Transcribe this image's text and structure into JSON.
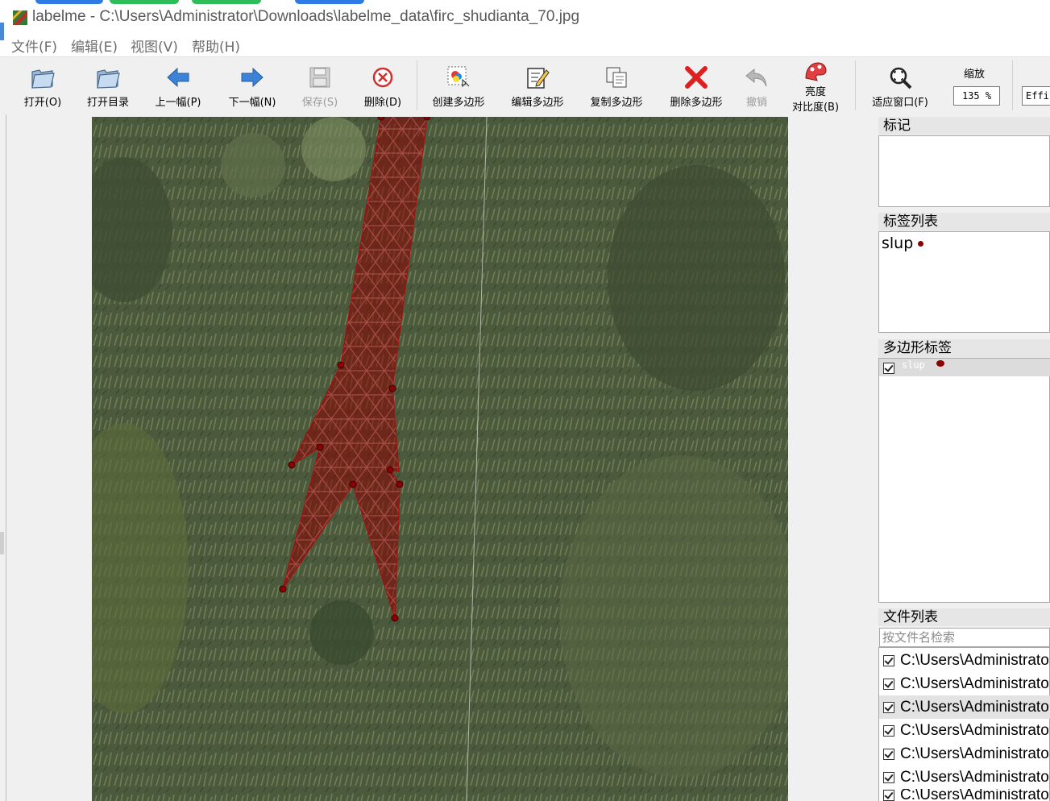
{
  "window": {
    "title": "labelme - C:\\Users\\Administrator\\Downloads\\labelme_data\\firc_shudianta_70.jpg"
  },
  "menu": [
    "文件(F)",
    "编辑(E)",
    "视图(V)",
    "帮助(H)"
  ],
  "toolbar": {
    "open": "打开(O)",
    "open_dir": "打开目录",
    "prev": "上一幅(P)",
    "next": "下一幅(N)",
    "save": "保存(S)",
    "delete": "删除(D)",
    "create_polygon": "创建多边形",
    "edit_polygon": "编辑多边形",
    "copy_polygon": "复制多边形",
    "delete_polygon": "删除多边形",
    "undo": "撤销",
    "brightness_line1": "亮度",
    "brightness_line2": "对比度(B)",
    "fit_window": "适应窗口(F)",
    "zoom_label": "缩放",
    "zoom_value": "135 %",
    "effi_text": "Effi"
  },
  "docks": {
    "flags_title": "标记",
    "label_list_title": "标签列表",
    "label_list": [
      {
        "name": "slup",
        "color": "#8b0000"
      }
    ],
    "polygon_labels_title": "多边形标签",
    "polygon_labels": [
      {
        "name": "slup",
        "checked": true,
        "color": "#8b0000"
      }
    ],
    "file_list_title": "文件列表",
    "file_search_placeholder": "按文件名检索",
    "files": [
      {
        "path": "C:\\Users\\Administrator",
        "checked": true,
        "selected": false
      },
      {
        "path": "C:\\Users\\Administrator",
        "checked": true,
        "selected": false
      },
      {
        "path": "C:\\Users\\Administrator",
        "checked": true,
        "selected": true
      },
      {
        "path": "C:\\Users\\Administrator",
        "checked": true,
        "selected": false
      },
      {
        "path": "C:\\Users\\Administrator",
        "checked": true,
        "selected": false
      },
      {
        "path": "C:\\Users\\Administrator",
        "checked": true,
        "selected": false
      },
      {
        "path": "C:\\Users\\Administrator",
        "checked": true,
        "selected": false
      }
    ]
  },
  "colors": {
    "polygon_fill": "#8b0000",
    "vegetation": "#4a5a3a"
  }
}
